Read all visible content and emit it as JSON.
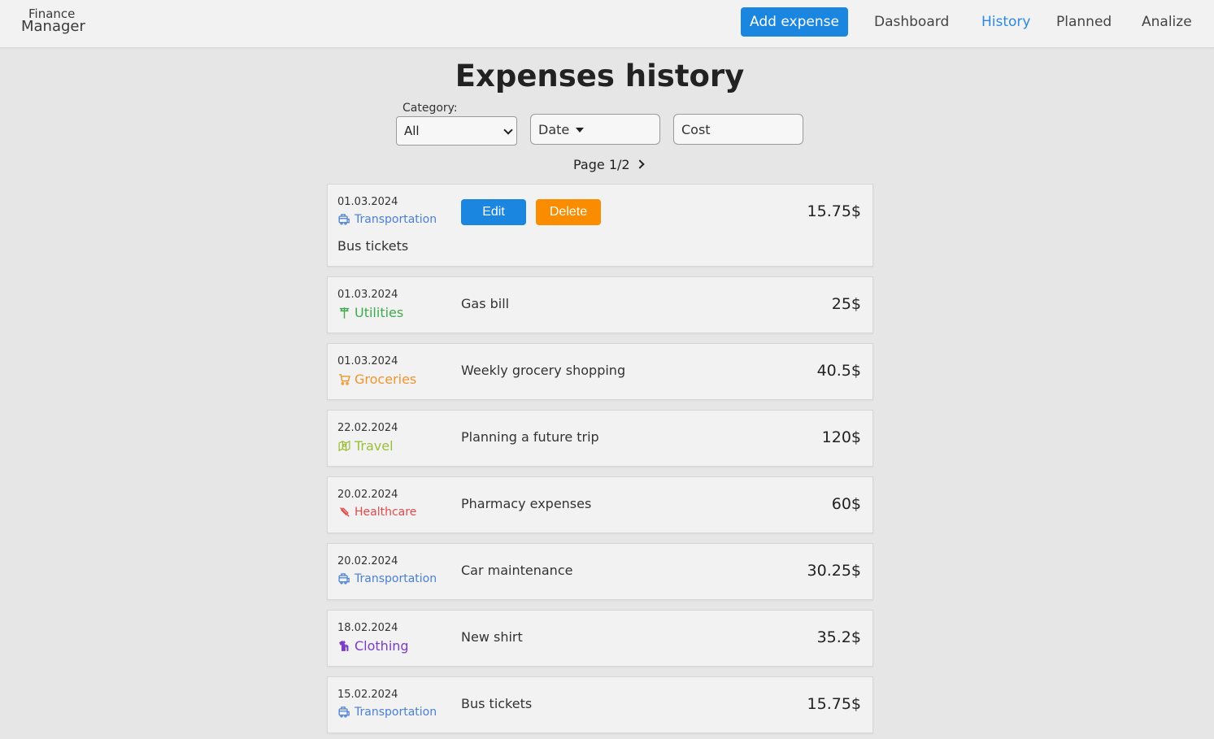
{
  "app": {
    "logo_line1": "Finance",
    "logo_line2": "Manager"
  },
  "nav": {
    "add_expense": "Add expense",
    "dashboard": "Dashboard",
    "history": "History",
    "planned": "Planned",
    "analize": "Analize"
  },
  "page": {
    "title": "Expenses history"
  },
  "filters": {
    "category_label": "Category:",
    "category_value": "All",
    "date_sort": "Date",
    "cost_sort": "Cost"
  },
  "pagination": {
    "label": "Page 1/2"
  },
  "actions": {
    "edit": "Edit",
    "delete": "Delete"
  },
  "colors": {
    "accent": "#1a86e0",
    "delete": "#fa8c00",
    "transportation": "#4a7fd4",
    "utilities": "#3faa4e",
    "groceries": "#f0952c",
    "travel": "#9bbf3a",
    "healthcare": "#e24a4a",
    "clothing": "#7a3dc8"
  },
  "expenses": [
    {
      "date": "01.03.2024",
      "category": "Transportation",
      "icon": "bus-icon",
      "description": "Bus tickets",
      "amount": "15.75$"
    },
    {
      "date": "01.03.2024",
      "category": "Utilities",
      "icon": "utility-pole-icon",
      "description": "Gas bill",
      "amount": "25$"
    },
    {
      "date": "01.03.2024",
      "category": "Groceries",
      "icon": "cart-icon",
      "description": "Weekly grocery shopping",
      "amount": "40.5$"
    },
    {
      "date": "22.02.2024",
      "category": "Travel",
      "icon": "map-icon",
      "description": "Planning a future trip",
      "amount": "120$"
    },
    {
      "date": "20.02.2024",
      "category": "Healthcare",
      "icon": "syringe-icon",
      "description": "Pharmacy expenses",
      "amount": "60$"
    },
    {
      "date": "20.02.2024",
      "category": "Transportation",
      "icon": "bus-icon",
      "description": "Car maintenance",
      "amount": "30.25$"
    },
    {
      "date": "18.02.2024",
      "category": "Clothing",
      "icon": "shirt-icon",
      "description": "New shirt",
      "amount": "35.2$"
    },
    {
      "date": "15.02.2024",
      "category": "Transportation",
      "icon": "bus-icon",
      "description": "Bus tickets",
      "amount": "15.75$"
    }
  ]
}
